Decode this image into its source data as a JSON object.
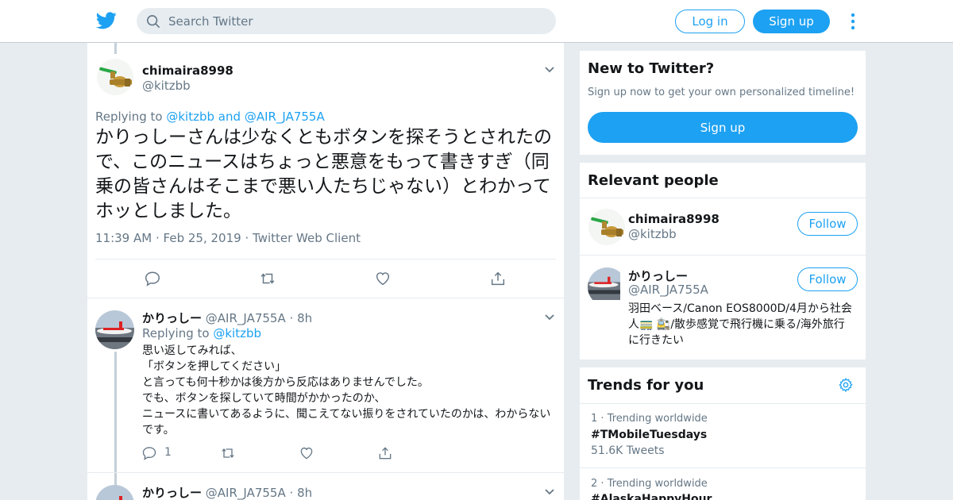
{
  "header": {
    "search_placeholder": "Search Twitter",
    "login_label": "Log in",
    "signup_label": "Sign up"
  },
  "main_tweet": {
    "display_name": "chimaira8998",
    "handle": "@kitzbb",
    "replying_prefix": "Replying to",
    "replying_user1": "@kitzbb",
    "replying_and": "and",
    "replying_user2": "@AIR_JA755A",
    "text": "かりっしーさんは少なくともボタンを探そうとされたので、このニュースはちょっと悪意をもって書きすぎ（同乗の皆さんはそこまで悪い人たちじゃない）とわかってホッとしました。",
    "time": "11:39 AM",
    "date": "Feb 25, 2019",
    "source": "Twitter Web Client"
  },
  "reply_tweet": {
    "display_name": "かりっしー",
    "handle": "@AIR_JA755A",
    "age": "8h",
    "replying_prefix": "Replying to",
    "replying_user": "@kitzbb",
    "lines": [
      "思い返してみれば、",
      "「ボタンを押してください」",
      "と言っても何十秒かは後方から反応はありませんでした。",
      "でも、ボタンを探していて時間がかかったのか、",
      "ニュースに書いてあるように、聞こえてない振りをされていたのかは、わからないです。"
    ],
    "reply_count": "1"
  },
  "next_tweet": {
    "display_name": "かりっしー",
    "handle": "@AIR_JA755A",
    "age": "8h"
  },
  "sidebar": {
    "new_title": "New to Twitter?",
    "new_sub": "Sign up now to get your own personalized timeline!",
    "signup_label": "Sign up",
    "relevant_title": "Relevant people",
    "people": [
      {
        "name": "chimaira8998",
        "handle": "@kitzbb",
        "follow": "Follow"
      },
      {
        "name": "かりっしー",
        "handle": "@AIR_JA755A",
        "follow": "Follow",
        "bio": "羽田ベース/Canon EOS8000D/4月から社会人🚃 🚉/散歩感覚で飛行機に乗る/海外旅行に行きたい"
      }
    ],
    "trends_title": "Trends for you",
    "trends": [
      {
        "rank": "1",
        "meta": "Trending worldwide",
        "tag": "#TMobileTuesdays",
        "count": "51.6K Tweets"
      },
      {
        "rank": "2",
        "meta": "Trending worldwide",
        "tag": "#AlaskaHappyHour"
      }
    ]
  },
  "colors": {
    "accent": "#1da1f2",
    "background": "#e6ecf0",
    "secondary_text": "#657786"
  }
}
